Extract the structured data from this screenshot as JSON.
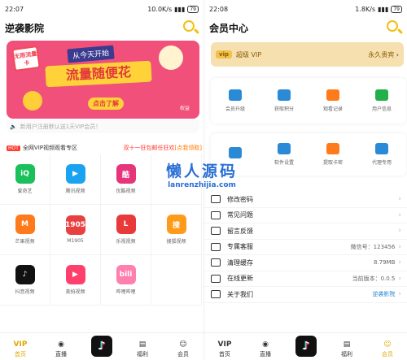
{
  "left": {
    "status": {
      "time": "22:07",
      "speed": "10.0K/s",
      "battery": "79"
    },
    "title": "逆袭影院",
    "banner": {
      "badge": "无限流量卡",
      "subtitle": "从今天开始",
      "headline": "流量随便花",
      "cta": "点击了解",
      "tag": "权益"
    },
    "notice": "新用户注册默认送1天VIP会员！",
    "vip_strip": {
      "hot": "HOT",
      "text": "全网VIP视频观看专区",
      "promo": "双十一狂包邮任狂欢",
      "promo_link": "[点我领取]"
    },
    "grid": [
      {
        "label": "爱奇艺",
        "icon": "iqiyi-icon",
        "color": "#19c05b",
        "glyph": "iQ"
      },
      {
        "label": "腾讯视频",
        "icon": "tencent-video-icon",
        "color": "#1aa3f0",
        "glyph": "▶"
      },
      {
        "label": "优酷视频",
        "icon": "youku-icon",
        "color": "#e6357b",
        "glyph": "酷"
      },
      {
        "label": "",
        "icon": "blank-icon",
        "color": "#ffffff",
        "glyph": ""
      },
      {
        "label": "芒果视频",
        "icon": "mango-icon",
        "color": "#ff7a1a",
        "glyph": "M"
      },
      {
        "label": "M1905",
        "icon": "m1905-icon",
        "color": "#e84040",
        "glyph": "1905"
      },
      {
        "label": "乐视视频",
        "icon": "letv-icon",
        "color": "#e83a3a",
        "glyph": "L"
      },
      {
        "label": "搜狐视频",
        "icon": "sohu-icon",
        "color": "#ff9b1a",
        "glyph": "搜"
      },
      {
        "label": "抖音视频",
        "icon": "douyin-icon",
        "color": "#111111",
        "glyph": "♪"
      },
      {
        "label": "美拍视频",
        "icon": "meipai-icon",
        "color": "#ff3f6c",
        "glyph": "▶"
      },
      {
        "label": "哔哩哔哩",
        "icon": "bilibili-icon",
        "color": "#ff7fae",
        "glyph": "bili"
      },
      {
        "label": "",
        "icon": "blank-icon",
        "color": "#ffffff",
        "glyph": ""
      }
    ],
    "tabs": [
      {
        "label": "首页",
        "icon": "vip-icon",
        "glyph": "VIP",
        "active": true
      },
      {
        "label": "直播",
        "icon": "live-icon",
        "glyph": "◉"
      },
      {
        "label": "",
        "icon": "douyin-tab-icon",
        "glyph": "♪"
      },
      {
        "label": "福利",
        "icon": "gift-icon",
        "glyph": "▤"
      },
      {
        "label": "会员",
        "icon": "member-icon",
        "glyph": "☺"
      }
    ]
  },
  "right": {
    "status": {
      "time": "22:08",
      "speed": "1.8K/s",
      "battery": "79"
    },
    "title": "会员中心",
    "vip": {
      "logo": "vip",
      "name": "超级 VIP",
      "perm": "永久贵宾"
    },
    "panel1": [
      {
        "label": "会员升级",
        "icon": "wallet-icon",
        "color": "#2a8ad6"
      },
      {
        "label": "获取积分",
        "icon": "gift-box-icon",
        "color": "#2a8ad6"
      },
      {
        "label": "观看记录",
        "icon": "history-icon",
        "color": "#ff7a1a"
      },
      {
        "label": "用户信息",
        "icon": "home-icon",
        "color": "#22b04a"
      }
    ],
    "panel2": [
      {
        "label": "",
        "icon": "user-card-icon",
        "color": "#2a8ad6"
      },
      {
        "label": "软件设置",
        "icon": "folder-icon",
        "color": "#2a8ad6"
      },
      {
        "label": "提取卡密",
        "icon": "flower-icon",
        "color": "#ff7a1a"
      },
      {
        "label": "代理专用",
        "icon": "card-icon",
        "color": "#2a8ad6"
      }
    ],
    "watermark": {
      "cn": "懒人源码",
      "url": "lanrenzhijia.com"
    },
    "menu": [
      {
        "label": "修改密码",
        "icon": "lock-icon",
        "value": ""
      },
      {
        "label": "常见问题",
        "icon": "question-icon",
        "value": ""
      },
      {
        "label": "留言反馈",
        "icon": "feedback-icon",
        "value": ""
      },
      {
        "label": "专属客服",
        "icon": "service-icon",
        "value": "微信号：123456"
      },
      {
        "label": "清理缓存",
        "icon": "trash-icon",
        "value": "8.79MB"
      },
      {
        "label": "在线更新",
        "icon": "refresh-icon",
        "value": "当前版本：0.0.5"
      },
      {
        "label": "关于我们",
        "icon": "info-icon",
        "value": "逆袭影院",
        "blue": true
      }
    ],
    "tabs": [
      {
        "label": "首页",
        "icon": "vip-icon",
        "glyph": "VIP"
      },
      {
        "label": "直播",
        "icon": "live-icon",
        "glyph": "◉"
      },
      {
        "label": "",
        "icon": "douyin-tab-icon",
        "glyph": "♪"
      },
      {
        "label": "福利",
        "icon": "gift-icon",
        "glyph": "▤"
      },
      {
        "label": "会员",
        "icon": "member-icon",
        "glyph": "☺",
        "active": true
      }
    ]
  }
}
